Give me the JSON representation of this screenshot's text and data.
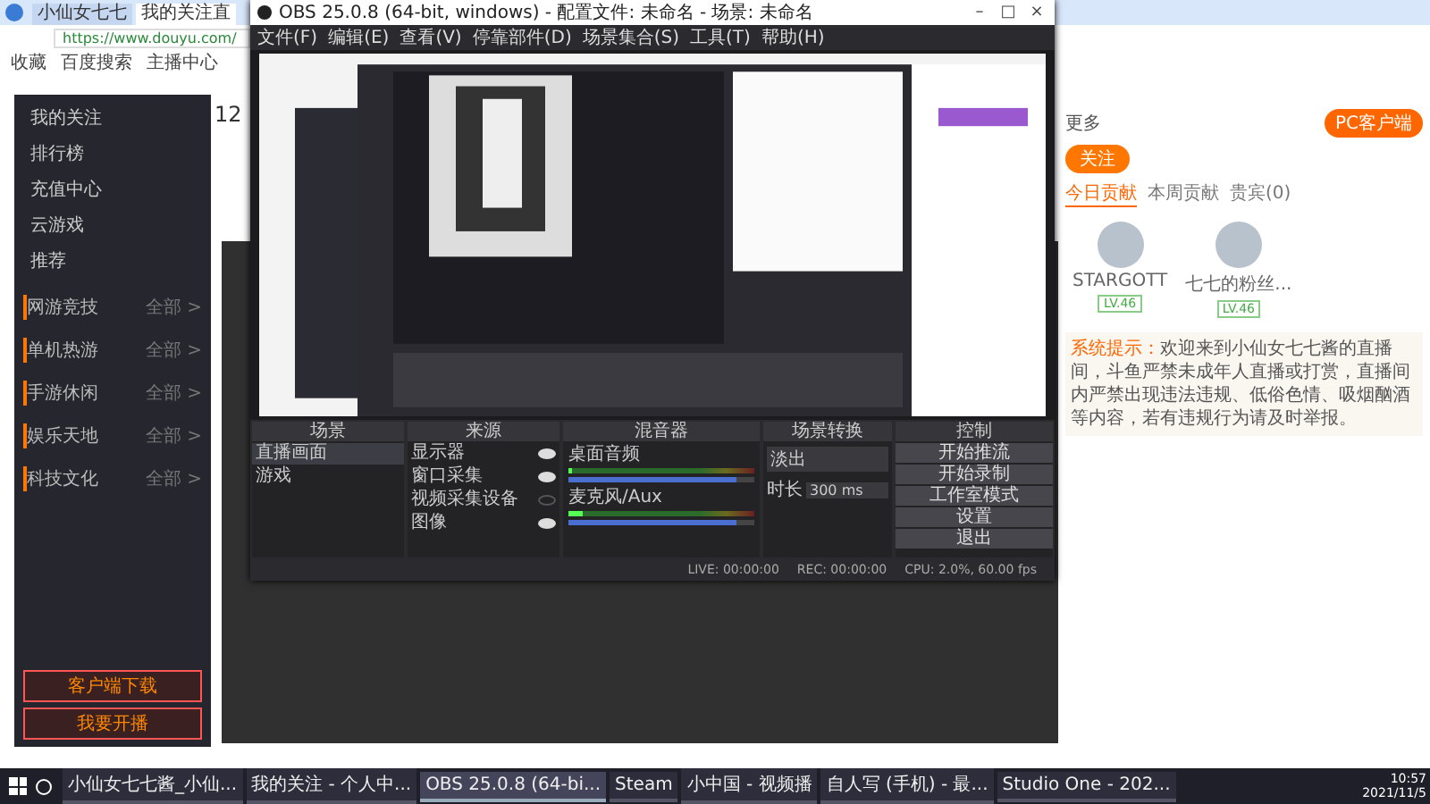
{
  "browser": {
    "tabs": [
      {
        "label": "小仙女七七",
        "selected": false
      },
      {
        "label": "我的关注直",
        "selected": true
      }
    ],
    "url": "https://www.douyu.com/",
    "bookmarks": [
      "收藏",
      "百度搜索",
      "主播中心"
    ]
  },
  "sidebar": {
    "nav": [
      "我的关注",
      "排行榜",
      "充值中心",
      "云游戏",
      "推荐"
    ],
    "sections": [
      {
        "title": "网游竞技",
        "more": "全部 >"
      },
      {
        "title": "单机热游",
        "more": "全部 >"
      },
      {
        "title": "手游休闲",
        "more": "全部 >"
      },
      {
        "title": "娱乐天地",
        "more": "全部 >"
      },
      {
        "title": "科技文化",
        "more": "全部 >"
      }
    ],
    "buttons": [
      "客户端下载",
      "我要开播"
    ]
  },
  "room": {
    "count": "12"
  },
  "right_panel": {
    "more": "更多",
    "pc_button": "PC客户端",
    "follow": "关注",
    "tabs": [
      {
        "label": "今日贡献",
        "selected": true
      },
      {
        "label": "本周贡献",
        "selected": false
      },
      {
        "label": "贵宾(0)",
        "selected": false
      }
    ],
    "users": [
      {
        "name": "STARGOTT",
        "level": "LV.46"
      },
      {
        "name": "七七的粉丝...",
        "level": "LV.46"
      }
    ],
    "notice_label": "系统提示：",
    "notice": "欢迎来到小仙女七七酱的直播间，斗鱼严禁未成年人直播或打赏，直播间内严禁出现违法违规、低俗色情、吸烟酗酒等内容，若有违规行为请及时举报。"
  },
  "obs": {
    "title": "OBS 25.0.8 (64-bit, windows) - 配置文件: 未命名 - 场景: 未命名",
    "window_controls": [
      "–",
      "□",
      "×"
    ],
    "menu": [
      "文件(F)",
      "编辑(E)",
      "查看(V)",
      "停靠部件(D)",
      "场景集合(S)",
      "工具(T)",
      "帮助(H)"
    ],
    "docks": {
      "scenes": "场景",
      "sources": "来源",
      "mixer": "混音器",
      "transitions": "场景转换",
      "controls": "控制"
    },
    "scenes": [
      {
        "label": "直播画面",
        "selected": true
      },
      {
        "label": "游戏",
        "selected": false
      }
    ],
    "sources": [
      {
        "label": "显示器",
        "visible": true
      },
      {
        "label": "窗口采集",
        "visible": true
      },
      {
        "label": "视频采集设备",
        "visible": false
      },
      {
        "label": "图像",
        "visible": true
      }
    ],
    "channels": [
      {
        "name": "桌面音频",
        "meter": {
          "level": 0.0
        },
        "volume": {
          "level": 0.9
        }
      },
      {
        "name": "麦克风/Aux",
        "meter": {
          "level": 0.08
        },
        "volume": {
          "level": 0.9
        }
      }
    ],
    "transition": {
      "type": "淡出",
      "duration_label": "时长",
      "duration": "300 ms"
    },
    "controls": [
      "开始推流",
      "开始录制",
      "工作室模式",
      "设置",
      "退出"
    ],
    "status": [
      "LIVE: 00:00:00",
      "REC: 00:00:00",
      "CPU: 2.0%, 60.00 fps"
    ]
  },
  "taskbar": {
    "items": [
      {
        "label": "小仙女七七酱_小仙...",
        "active": false
      },
      {
        "label": "我的关注 - 个人中...",
        "active": false
      },
      {
        "label": "OBS 25.0.8 (64-bi...",
        "active": true
      },
      {
        "label": "Steam",
        "active": false
      },
      {
        "label": "小中国 - 视频播",
        "active": false
      },
      {
        "label": "自人写 (手机) - 最...",
        "active": false
      },
      {
        "label": "Studio One - 202...",
        "active": false
      }
    ],
    "time": "10:57",
    "date": "2021/11/5"
  }
}
